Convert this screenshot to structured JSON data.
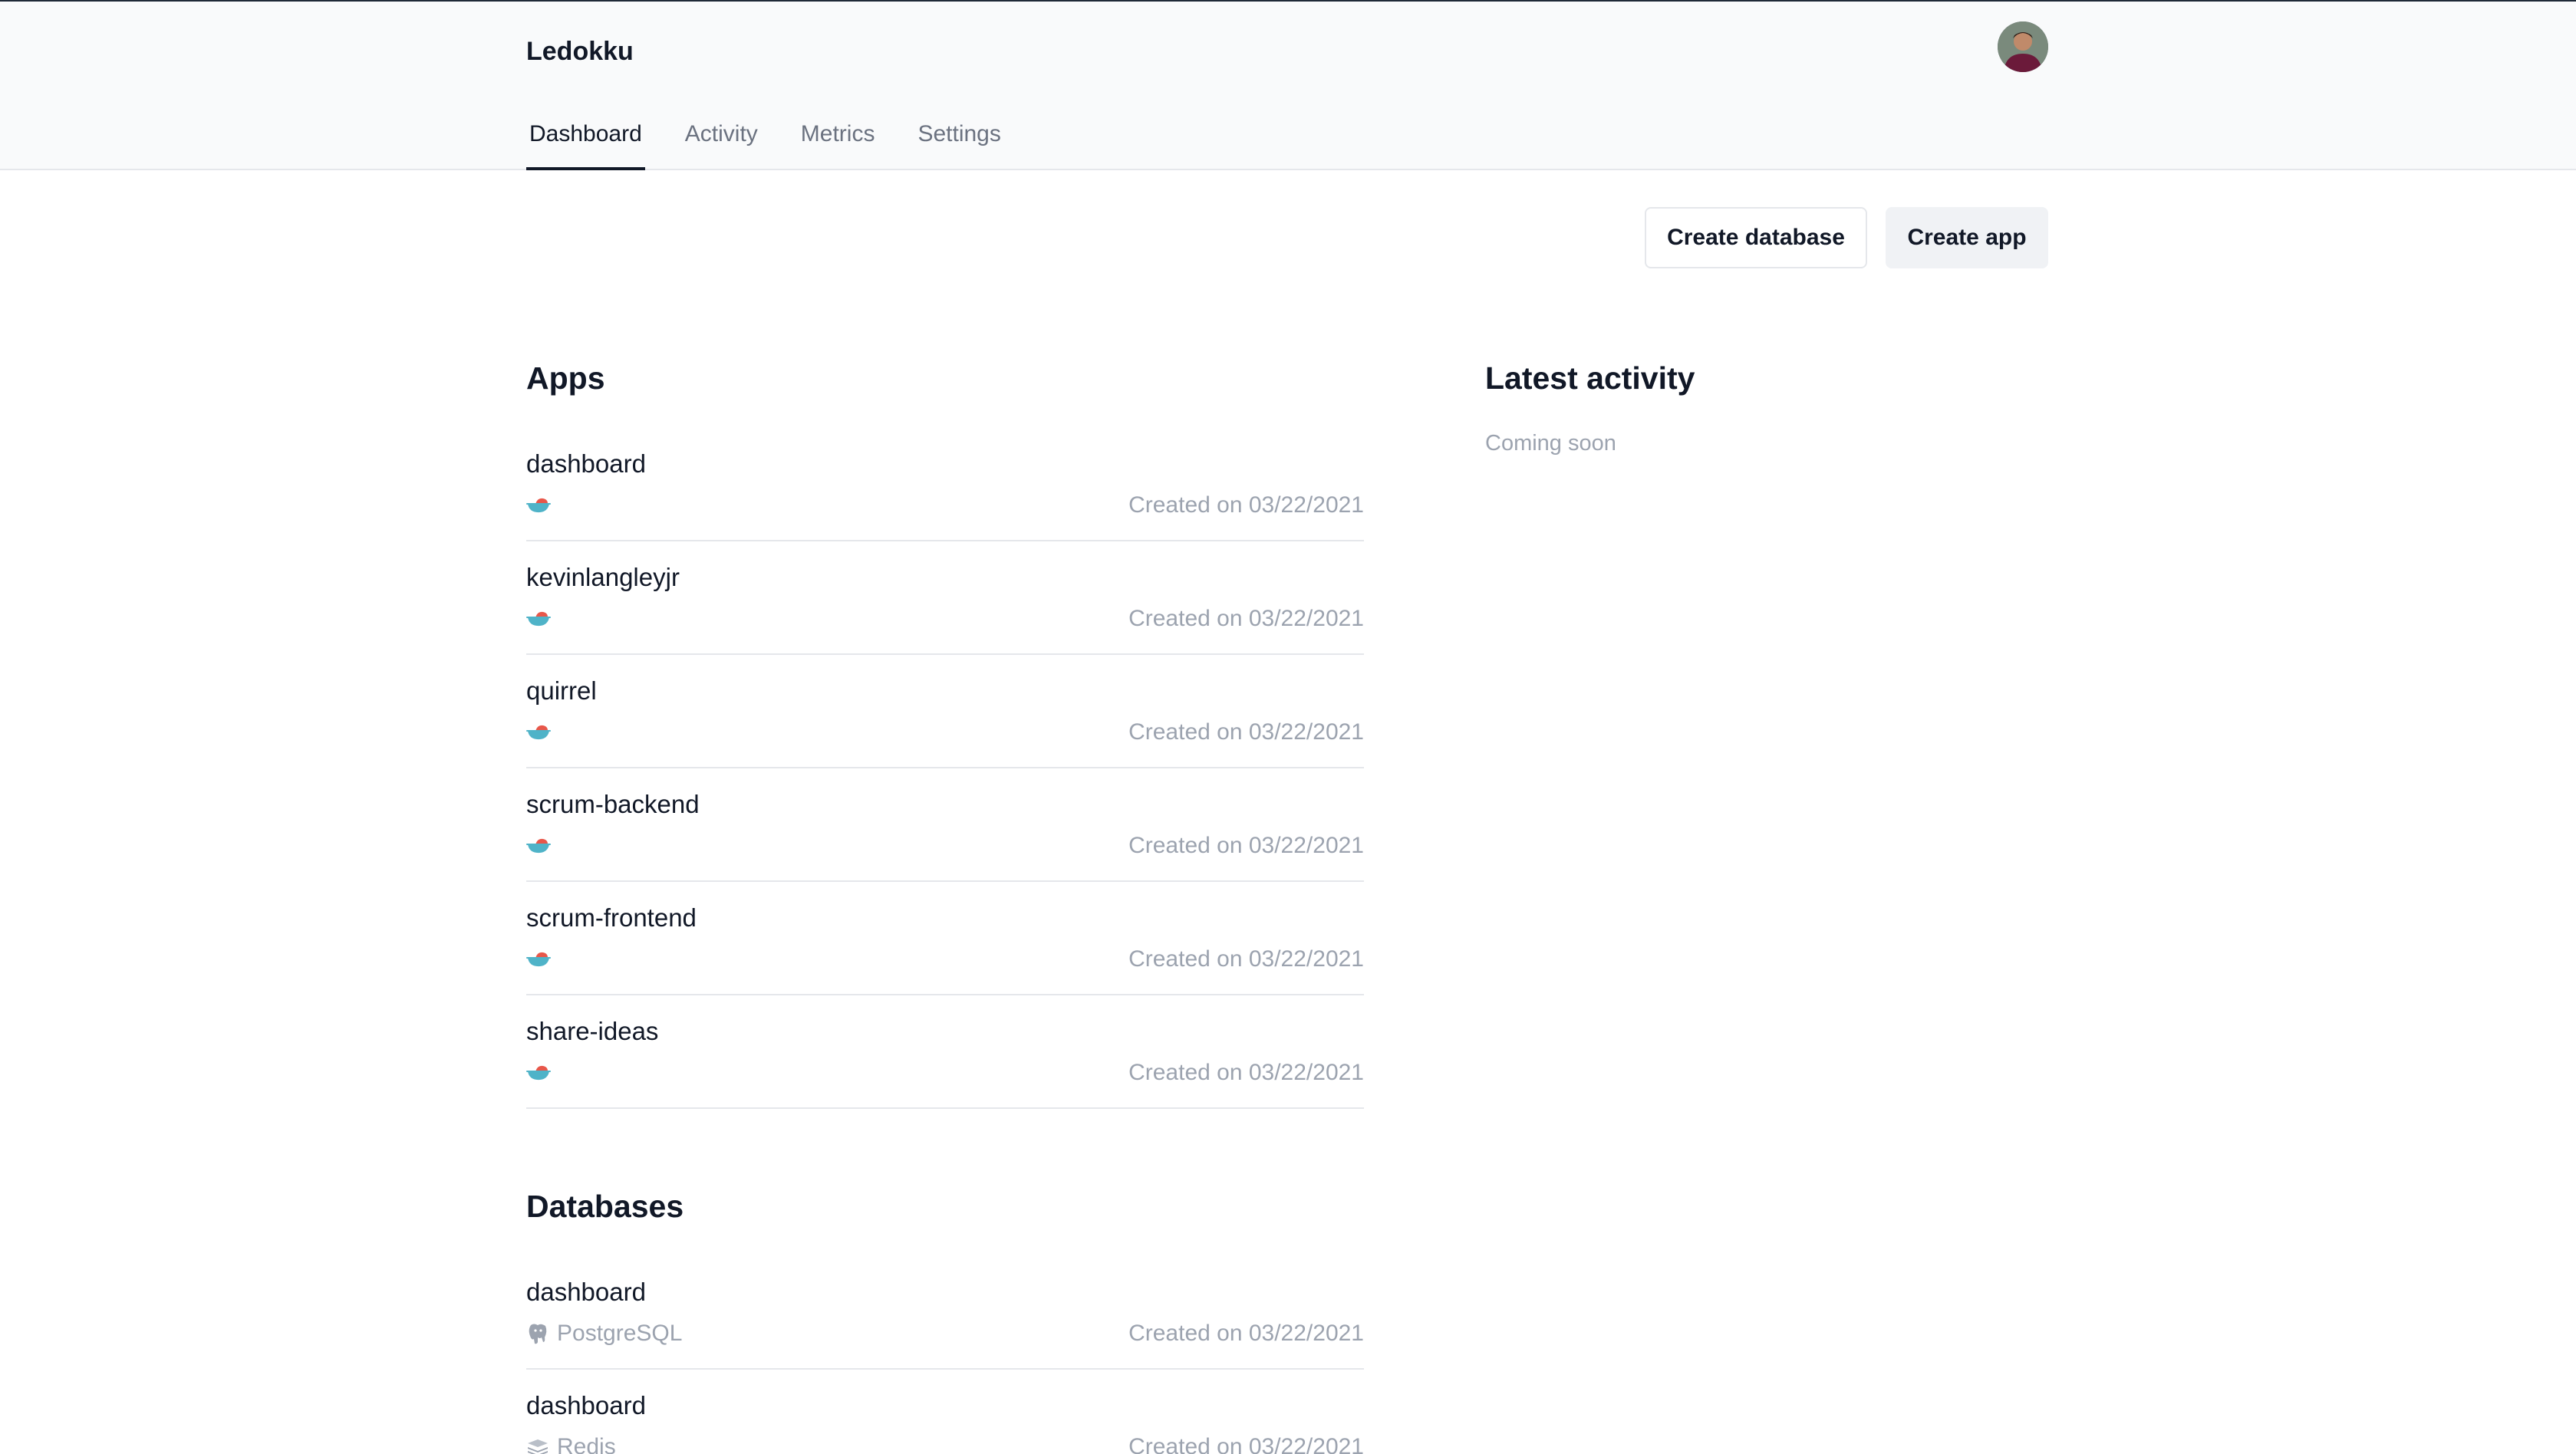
{
  "header": {
    "brand": "Ledokku",
    "tabs": [
      {
        "label": "Dashboard",
        "active": true
      },
      {
        "label": "Activity",
        "active": false
      },
      {
        "label": "Metrics",
        "active": false
      },
      {
        "label": "Settings",
        "active": false
      }
    ],
    "avatar_icon": "user-avatar"
  },
  "actions": {
    "create_database": "Create database",
    "create_app": "Create app"
  },
  "apps": {
    "title": "Apps",
    "items": [
      {
        "name": "dashboard",
        "icon": "dokku-whale-icon",
        "created": "Created on 03/22/2021"
      },
      {
        "name": "kevinlangleyjr",
        "icon": "dokku-whale-icon",
        "created": "Created on 03/22/2021"
      },
      {
        "name": "quirrel",
        "icon": "dokku-whale-icon",
        "created": "Created on 03/22/2021"
      },
      {
        "name": "scrum-backend",
        "icon": "dokku-whale-icon",
        "created": "Created on 03/22/2021"
      },
      {
        "name": "scrum-frontend",
        "icon": "dokku-whale-icon",
        "created": "Created on 03/22/2021"
      },
      {
        "name": "share-ideas",
        "icon": "dokku-whale-icon",
        "created": "Created on 03/22/2021"
      }
    ]
  },
  "databases": {
    "title": "Databases",
    "items": [
      {
        "name": "dashboard",
        "type": "PostgreSQL",
        "icon": "postgresql-icon",
        "created": "Created on 03/22/2021"
      },
      {
        "name": "dashboard",
        "type": "Redis",
        "icon": "redis-icon",
        "created": "Created on 03/22/2021"
      }
    ]
  },
  "activity": {
    "title": "Latest activity",
    "empty_text": "Coming soon"
  },
  "colors": {
    "header_bg": "#f9fafb",
    "text_primary": "#111827",
    "text_muted": "#9ca3af",
    "border": "#e5e7eb"
  }
}
